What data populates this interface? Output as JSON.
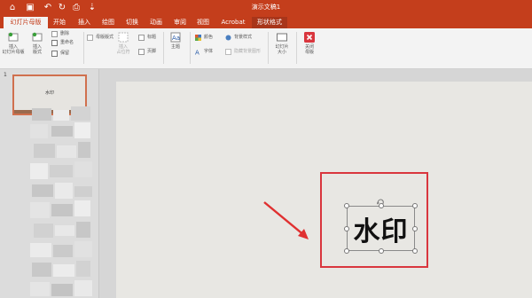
{
  "window": {
    "title": "演示文稿1"
  },
  "quick_access": {
    "home_icon": "⌂",
    "save_icon": "▣",
    "undo_icon": "↶",
    "redo_icon": "↻",
    "print_icon": "⎙",
    "more_icon": "⇣"
  },
  "tabs": [
    {
      "label": "幻灯片母版"
    },
    {
      "label": "开始"
    },
    {
      "label": "插入"
    },
    {
      "label": "绘图"
    },
    {
      "label": "切换"
    },
    {
      "label": "动画"
    },
    {
      "label": "审阅"
    },
    {
      "label": "视图"
    },
    {
      "label": "Acrobat"
    },
    {
      "label": "形状格式"
    }
  ],
  "ribbon": {
    "insert_master": "插入\n幻灯片母版",
    "insert_layout": "插入\n版式",
    "delete": "删除",
    "rename": "重命名",
    "preserve": "保留",
    "master_layout": "母版版式",
    "insert_placeholder": "插入\n占位符",
    "title": "标题",
    "footer": "页脚",
    "theme": "主题",
    "colors": "颜色",
    "fonts": "字体",
    "background_styles": "背景样式",
    "hide_bg_graphics": "隐藏背景图形",
    "slide_size": "幻灯片\n大小",
    "close_master": "关闭\n母版"
  },
  "thumbnails": {
    "slide_number": "1",
    "thumb_text": "水印"
  },
  "slide": {
    "watermark_text": "水印"
  },
  "colors": {
    "accent": "#c43e1c",
    "highlight": "#d9363e",
    "arrow": "#e03030"
  }
}
